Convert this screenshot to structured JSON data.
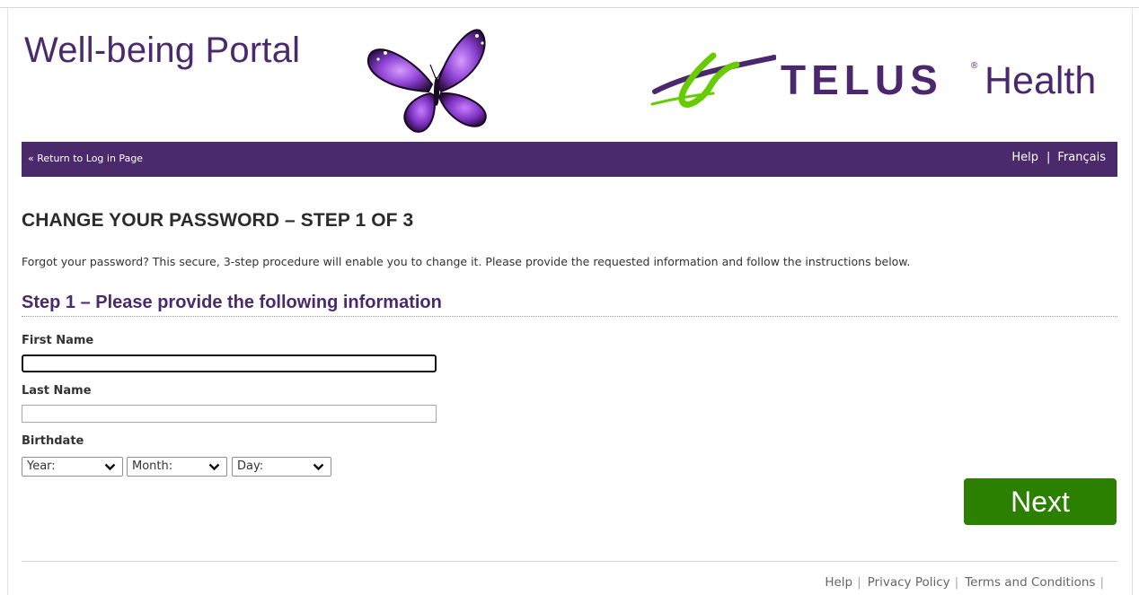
{
  "header": {
    "portal_title": "Well-being Portal",
    "brand_word": "TELUS",
    "brand_registered": "®",
    "brand_suffix": "Health"
  },
  "nav": {
    "return_link": "« Return to Log in Page",
    "help_link": "Help",
    "separator": "|",
    "language_link": "Français"
  },
  "page": {
    "heading": "CHANGE YOUR PASSWORD – STEP 1 OF 3",
    "intro": "Forgot your password? This secure, 3-step procedure will enable you to change it. Please provide the requested information and follow the instructions below.",
    "step_heading": "Step 1 – Please provide the following information"
  },
  "form": {
    "first_name_label": "First Name",
    "first_name_value": "",
    "last_name_label": "Last Name",
    "last_name_value": "",
    "birthdate_label": "Birthdate",
    "year_select": "Year:",
    "month_select": "Month:",
    "day_select": "Day:",
    "next_button": "Next"
  },
  "footer": {
    "help": "Help",
    "privacy": "Privacy Policy",
    "terms": "Terms and Conditions",
    "separator": "|"
  },
  "colors": {
    "brand_purple": "#4b2a6b",
    "telus_green": "#66cc00",
    "next_green": "#2b8000"
  },
  "icons": {
    "butterfly": "butterfly-image",
    "telus_mark": "telus-swoosh-logo",
    "select_arrow": "chevron-down-icon"
  }
}
